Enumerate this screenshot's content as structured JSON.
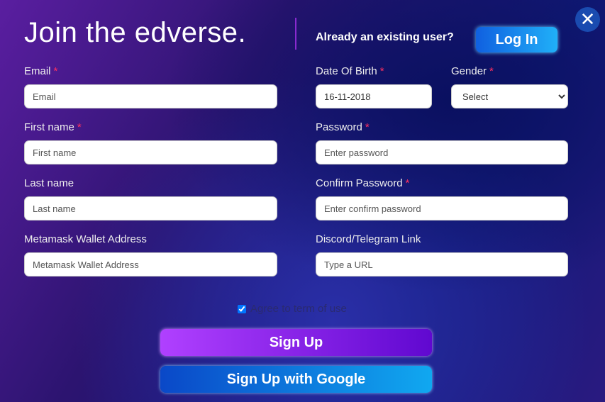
{
  "header": {
    "title": "Join the edverse.",
    "already_text": "Already an existing user?",
    "login_label": "Log In",
    "close_icon": "close-icon"
  },
  "form": {
    "required_mark": "*",
    "email": {
      "label": "Email",
      "placeholder": "Email"
    },
    "first_name": {
      "label": "First name",
      "placeholder": "First name"
    },
    "last_name": {
      "label": "Last name",
      "placeholder": "Last name"
    },
    "wallet": {
      "label": "Metamask Wallet Address",
      "placeholder": "Metamask Wallet Address"
    },
    "dob": {
      "label": "Date Of Birth",
      "value": "16-11-2018"
    },
    "gender": {
      "label": "Gender",
      "selected": "Select"
    },
    "password": {
      "label": "Password",
      "placeholder": "Enter password"
    },
    "confirm_password": {
      "label": "Confirm Password",
      "placeholder": "Enter confirm password"
    },
    "link": {
      "label": "Discord/Telegram Link",
      "placeholder": "Type a URL"
    },
    "terms": {
      "label": "Agree to term of use",
      "checked": true
    }
  },
  "actions": {
    "signup_label": "Sign Up",
    "google_label": "Sign Up with Google"
  },
  "colors": {
    "required": "#ff3060",
    "signup": "#9b30f0",
    "google": "#1080e0",
    "login": "#1890f0"
  }
}
